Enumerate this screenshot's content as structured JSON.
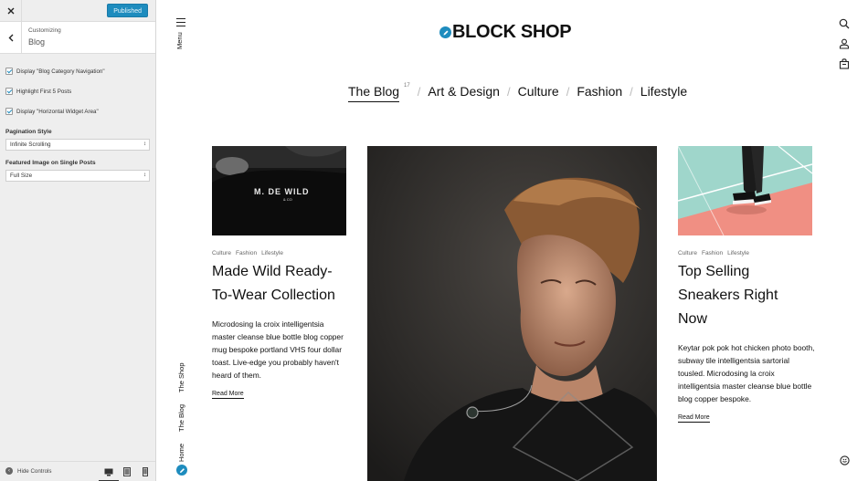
{
  "customizer": {
    "publish_label": "Published",
    "header_sub": "Customizing",
    "header_title": "Blog",
    "checkboxes": [
      {
        "label": "Display \"Blog Category Navigation\"",
        "checked": true
      },
      {
        "label": "Highlight First 5 Posts",
        "checked": true
      },
      {
        "label": "Display \"Horizontal Widget Area\"",
        "checked": true
      }
    ],
    "pagination": {
      "label": "Pagination Style",
      "value": "Infinite Scrolling"
    },
    "featured": {
      "label": "Featured Image on Single Posts",
      "value": "Full Size"
    },
    "hide_controls_label": "Hide Controls",
    "devices": [
      "desktop-icon",
      "tablet-icon",
      "mobile-icon"
    ]
  },
  "site": {
    "menu_label": "Menu",
    "logo_text": "BLOCK SHOP",
    "left_links": [
      "The Shop",
      "The Blog",
      "Home"
    ],
    "category_nav": {
      "active": "The Blog",
      "count": "17",
      "items": [
        "Art & Design",
        "Culture",
        "Fashion",
        "Lifestyle"
      ]
    },
    "posts": [
      {
        "tags": [
          "Culture",
          "Fashion",
          "Lifestyle"
        ],
        "title": "Made Wild Ready-To-Wear Collection",
        "excerpt": "Microdosing la croix intelligentsia master cleanse blue bottle blog copper mug bespoke portland VHS four dollar toast. Live-edge you probably haven't heard of them.",
        "read_more": "Read More",
        "shirt_text": "M. DE WILD"
      },
      {
        "tags": [
          "Culture",
          "Fashion",
          "Lifestyle"
        ],
        "title": "Top Selling Sneakers Right Now",
        "excerpt": "Keytar pok pok hot chicken photo booth, subway tile intelligentsia sartorial tousled. Microdosing la croix intelligentsia master cleanse blue bottle blog copper bespoke.",
        "read_more": "Read More"
      }
    ]
  },
  "colors": {
    "accent": "#1e8cbe",
    "sidebar_bg": "#eeeeee"
  }
}
